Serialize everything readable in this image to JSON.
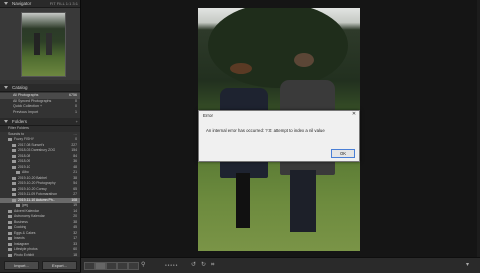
{
  "navigator": {
    "title": "Navigator",
    "zoom_options": "FIT FILL 1:1 3:1"
  },
  "catalog": {
    "title": "Catalog",
    "items": [
      {
        "label": "All Photographs",
        "count": "6756"
      },
      {
        "label": "All Synced Photographs",
        "count": "0"
      },
      {
        "label": "Quick Collection +",
        "count": "0"
      },
      {
        "label": "Previous Import",
        "count": "1"
      }
    ]
  },
  "folders": {
    "title": "Folders",
    "filter_label": "Filter Folders",
    "drive": {
      "name": "Sounds to",
      "info": "…"
    },
    "items": [
      {
        "label": "Fuzzy FISHY",
        "count": "0",
        "indent": 0
      },
      {
        "label": "2017-08 Sunset's",
        "count": "227",
        "indent": 1
      },
      {
        "label": "2018-03 Daresbury ZOO",
        "count": "154",
        "indent": 1
      },
      {
        "label": "2018-08",
        "count": "84",
        "indent": 1
      },
      {
        "label": "2018-09",
        "count": "36",
        "indent": 1
      },
      {
        "label": "2019-10",
        "count": "48",
        "indent": 1
      },
      {
        "label": "Aibo",
        "count": "21",
        "indent": 2
      },
      {
        "label": "2019-10-20 Babbel",
        "count": "38",
        "indent": 1
      },
      {
        "label": "2019-10-20 Photography",
        "count": "54",
        "indent": 1
      },
      {
        "label": "2019-10-20 Conwy",
        "count": "65",
        "indent": 1
      },
      {
        "label": "2019-11-09 Fotomarathon",
        "count": "27",
        "indent": 1
      },
      {
        "label": "2019-11-10 Autumn Ph...",
        "count": "108",
        "indent": 1,
        "selected": true
      },
      {
        "label": "jpeg",
        "count": "19",
        "indent": 2
      },
      {
        "label": "Advent Kalendar",
        "count": "14",
        "indent": 0
      },
      {
        "label": "Astronomy Kalendar",
        "count": "20",
        "indent": 0
      },
      {
        "label": "Business",
        "count": "38",
        "indent": 0
      },
      {
        "label": "Cooking",
        "count": "45",
        "indent": 0
      },
      {
        "label": "Eggs & Cakes",
        "count": "32",
        "indent": 0
      },
      {
        "label": "Insects",
        "count": "17",
        "indent": 0
      },
      {
        "label": "Instagram",
        "count": "33",
        "indent": 0
      },
      {
        "label": "Lifestyle photos",
        "count": "60",
        "indent": 0
      },
      {
        "label": "Photo Exhibit",
        "count": "18",
        "indent": 0
      }
    ]
  },
  "buttons": {
    "import": "Import...",
    "export": "Export..."
  },
  "dialog": {
    "title": "Error",
    "close": "✕",
    "message": "An internal error has occurred: ?:0: attempt to index a nil value",
    "ok": "OK"
  }
}
